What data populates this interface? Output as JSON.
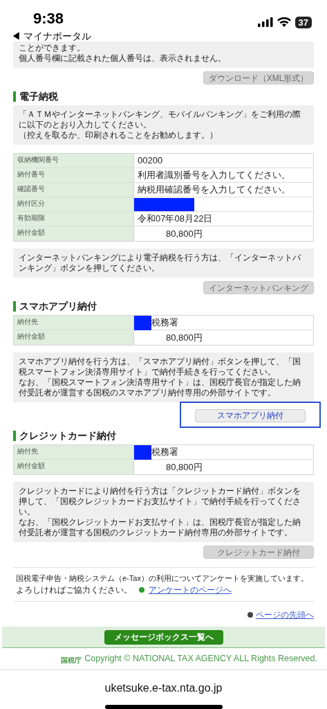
{
  "status_bar": {
    "time": "9:38",
    "back_label": "◀ マイナポータル",
    "battery": "37"
  },
  "intro": {
    "lines": [
      "ことができます。",
      "個人番号欄に記載された個人番号は、表示されません。"
    ]
  },
  "download_button": {
    "label": "ダウンロード（XML形式）",
    "disabled": true,
    "highlighted": false
  },
  "sections": [
    {
      "heading": "電子納税",
      "info": [
        "「ＡＴＭやインターネットバンキング、モバイルバンキング」をご利用の際に以下のとおり入力してください。",
        "（控えを取るか、印刷されることをお勧めします。）"
      ],
      "rows": [
        {
          "label": "収納機関番号",
          "value": "00200",
          "kind": "text"
        },
        {
          "label": "納付番号",
          "value": "利用者識別番号を入力してください。",
          "kind": "text"
        },
        {
          "label": "確認番号",
          "value": "納税用確認番号を入力してください。",
          "kind": "text"
        },
        {
          "label": "納付区分",
          "kind": "redacted"
        },
        {
          "label": "有効期限",
          "value": "令和07年08月22日",
          "kind": "text"
        },
        {
          "label": "納付金額",
          "value": "80,800円",
          "kind": "amount"
        }
      ],
      "note": [
        "インターネットバンキングにより電子納税を行う方は、「インターネットバンキング」ボタンを押してください。"
      ],
      "button": {
        "label": "インターネットバンキング",
        "disabled": true,
        "highlighted": false
      }
    },
    {
      "heading": "スマホアプリ納付",
      "rows": [
        {
          "label": "納付先",
          "value": "税務署",
          "kind": "redacted_prefix"
        },
        {
          "label": "納付金額",
          "value": "80,800円",
          "kind": "amount"
        }
      ],
      "note": [
        "スマホアプリ納付を行う方は、「スマホアプリ納付」ボタンを押して、「国税スマートフォン決済専用サイト」で納付手続きを行ってください。",
        "なお、「国税スマートフォン決済専用サイト」は、国税庁長官が指定した納付受託者が運営する国税のスマホアプリ納付専用の外部サイトです。"
      ],
      "button": {
        "label": "スマホアプリ納付",
        "disabled": false,
        "highlighted": true
      }
    },
    {
      "heading": "クレジットカード納付",
      "rows": [
        {
          "label": "納付先",
          "value": "税務署",
          "kind": "redacted_prefix"
        },
        {
          "label": "納付金額",
          "value": "80,800円",
          "kind": "amount"
        }
      ],
      "note": [
        "クレジットカードにより納付を行う方は「クレジットカード納付」ボタンを押して、「国税クレジットカードお支払サイト」で納付手続を行ってください。",
        "なお、「国税クレジットカードお支払サイト」は、国税庁長官が指定した納付受託者が運営する国税のクレジットカード納付専用の外部サイトです。"
      ],
      "button": {
        "label": "クレジットカード納付",
        "disabled": true,
        "highlighted": false
      }
    }
  ],
  "survey": {
    "text_line1": "国税電子申告・納税システム（e-Tax）の利用についてアンケートを実施しています。",
    "text_line2": "よろしければご協力ください。",
    "link": "アンケートのページへ"
  },
  "page_top_link": "ページの先頭へ",
  "footer": {
    "button": "メッセージボックス一覧へ",
    "agency_logo": "国税庁",
    "copyright": "Copyright © NATIONAL TAX AGENCY ALL Rights Reserved."
  },
  "url_bar": {
    "url": "uketsuke.e-tax.nta.go.jp"
  }
}
